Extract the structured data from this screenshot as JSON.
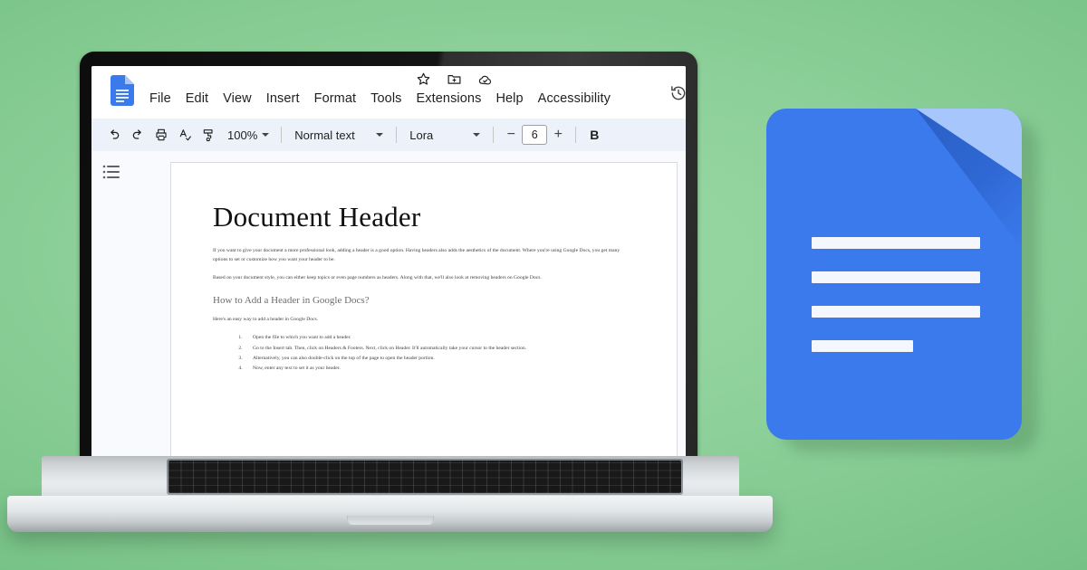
{
  "background": {
    "color": "#8ed09a"
  },
  "app": {
    "name": "Google Docs",
    "logo_icon": "google-docs-logo-icon",
    "quick_icons": [
      {
        "name": "star-icon",
        "label": "Star"
      },
      {
        "name": "move-to-folder-icon",
        "label": "Move"
      },
      {
        "name": "cloud-saved-icon",
        "label": "Saved to Drive"
      }
    ],
    "history_icon": "version-history-icon",
    "menu": [
      {
        "label": "File"
      },
      {
        "label": "Edit"
      },
      {
        "label": "View"
      },
      {
        "label": "Insert"
      },
      {
        "label": "Format"
      },
      {
        "label": "Tools"
      },
      {
        "label": "Extensions"
      },
      {
        "label": "Help"
      },
      {
        "label": "Accessibility"
      }
    ]
  },
  "toolbar": {
    "undo_icon": "undo-icon",
    "redo_icon": "redo-icon",
    "print_icon": "print-icon",
    "spellcheck_icon": "spellcheck-icon",
    "paint_format_icon": "paint-format-icon",
    "zoom_value": "100%",
    "paragraph_style": "Normal text",
    "font_family": "Lora",
    "font_size": "6",
    "decrease_label": "−",
    "increase_label": "+",
    "bold_label": "B"
  },
  "canvas": {
    "outline_icon": "document-outline-icon"
  },
  "document": {
    "title": "Document Header",
    "paragraphs": [
      "If you want to give your document a more professional look, adding a header is a good option. Having headers also adds the aesthetics of the document. Where you're using Google Docs, you get many options to set or customize how you want your header to be.",
      "Based on your document style, you can either keep topics or even page numbers as headers. Along with that, we'll also look at removing headers on Google Docs."
    ],
    "heading2": "How to Add a Header in Google Docs?",
    "intro": "Here's an easy way to add a header in Google Docs.",
    "steps": [
      "Open the file to which you want to add a header.",
      "Go to the Insert tab. Then, click on Headers & Footers. Next, click on Header. It'll automatically take your cursor to the header section.",
      "Alternatively, you can also double-click on the top of the page to open the header portion.",
      "Now, enter any text to set it as your header."
    ]
  },
  "brand_icon": {
    "name": "google-docs-icon",
    "body_color": "#3b7aed",
    "fold_light_color": "#a7c6fb",
    "fold_dark_color": "#2a5fc4",
    "line_color": "#f4f7fd",
    "line_widths": [
      186,
      186,
      186,
      112
    ]
  }
}
